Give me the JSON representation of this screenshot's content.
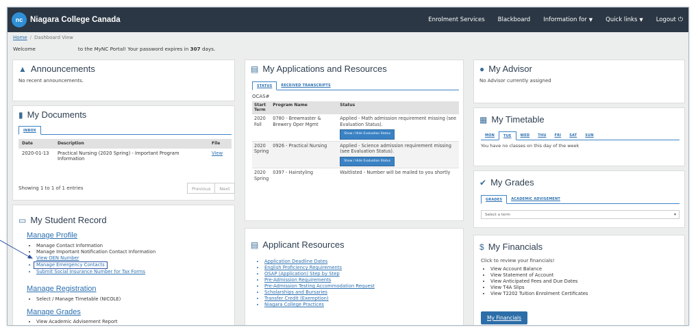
{
  "header": {
    "logo_text": "nc",
    "brand": "Niagara College Canada",
    "nav": [
      "Enrolment Services",
      "Blackboard",
      "Information for",
      "Quick links",
      "Logout"
    ]
  },
  "breadcrumb": {
    "home": "Home",
    "current": "Dashboard View"
  },
  "welcome": {
    "prefix": "Welcome",
    "middle": "to the MyNC Portal! Your password expires in",
    "days": "307",
    "suffix": "days."
  },
  "announcements": {
    "title": "Announcements",
    "empty": "No recent announcements."
  },
  "documents": {
    "title": "My Documents",
    "tab": "INBOX",
    "columns": [
      "Date",
      "Description",
      "File"
    ],
    "rows": [
      {
        "date": "2020-01-13",
        "description": "Practical Nursing (2020 Spring) - Important Program Information",
        "file": "View"
      }
    ],
    "showing": "Showing 1 to 1 of 1 entries",
    "prev": "Previous",
    "next": "Next"
  },
  "student_record": {
    "title": "My Student Record",
    "sections": [
      {
        "heading": "Manage Profile",
        "items": [
          "Manage Contact Information",
          "Manage Important Notification Contact Information",
          "View OEN Number",
          "Manage Emergency Contacts",
          "Submit Social Insurance Number for Tax Forms"
        ]
      },
      {
        "heading": "Manage Registration",
        "items": [
          "Select / Manage Timetable (NICOLE)"
        ]
      },
      {
        "heading": "Manage Grades",
        "items": [
          "View Academic Advisement Report"
        ]
      }
    ]
  },
  "applications": {
    "title": "My Applications and Resources",
    "tabs": [
      "STATUS",
      "RECEIVED TRANSCRIPTS"
    ],
    "ocas_label": "OCAS#",
    "columns": [
      "Start Term",
      "Program Name",
      "Status"
    ],
    "rows": [
      {
        "term": "2020 Fall",
        "program": "0780 - Brewmaster & Brewery Oper Mgmt",
        "status": "Applied - Math admission requirement missing (see Evaluation Status).",
        "button": "Show / Hide Evaluation Status"
      },
      {
        "term": "2020 Spring",
        "program": "0926 - Practical Nursing",
        "status": "Applied - Science admission requirement missing (see Evaluation Status).",
        "button": "Show / Hide Evaluation Status"
      },
      {
        "term": "2020 Spring",
        "program": "0397 - Hairstyling",
        "status": "Waitlisted - Number will be mailed to you shortly",
        "button": ""
      }
    ]
  },
  "applicant_resources": {
    "title": "Applicant Resources",
    "links": [
      "Application Deadline Dates",
      "English Proficiency Requirements",
      "OSAP (Application) Step by Step",
      "Pre-Admission Requirements",
      "Pre-Admission Testing Accommodation Request",
      "Scholarships and Bursaries",
      "Transfer Credit (Exemption)",
      "Niagara College Practices"
    ]
  },
  "advisor": {
    "title": "My Advisor",
    "empty": "No Advisor currently assigned"
  },
  "timetable": {
    "title": "My Timetable",
    "days": [
      "MON",
      "TUE",
      "WED",
      "THU",
      "FRI",
      "SAT",
      "SUN"
    ],
    "empty": "You have no classes on this day of the week"
  },
  "grades": {
    "title": "My Grades",
    "tabs": [
      "GRADES",
      "ACADEMIC ADVISEMENT"
    ],
    "select_placeholder": "Select a term"
  },
  "financials": {
    "title": "My Financials",
    "intro": "Click to review your financials!",
    "items": [
      "View Account Balance",
      "View Statement of Account",
      "View Anticipated Fees and Due Dates",
      "View T4A Slips",
      "View T2202 Tuition Enrolment Certificates"
    ],
    "button": "My Financials"
  },
  "icons": {
    "announcements": "bullhorn-icon",
    "documents": "file-icon",
    "student_record": "monitor-icon",
    "applications": "clipboard-icon",
    "advisor": "chat-icon",
    "timetable": "calendar-icon",
    "grades": "check-circle-icon",
    "financials": "dollar-icon"
  },
  "colors": {
    "topbar": "#2b3744",
    "accent": "#2a6fb0",
    "highlight_box": "#2b4fa0"
  }
}
